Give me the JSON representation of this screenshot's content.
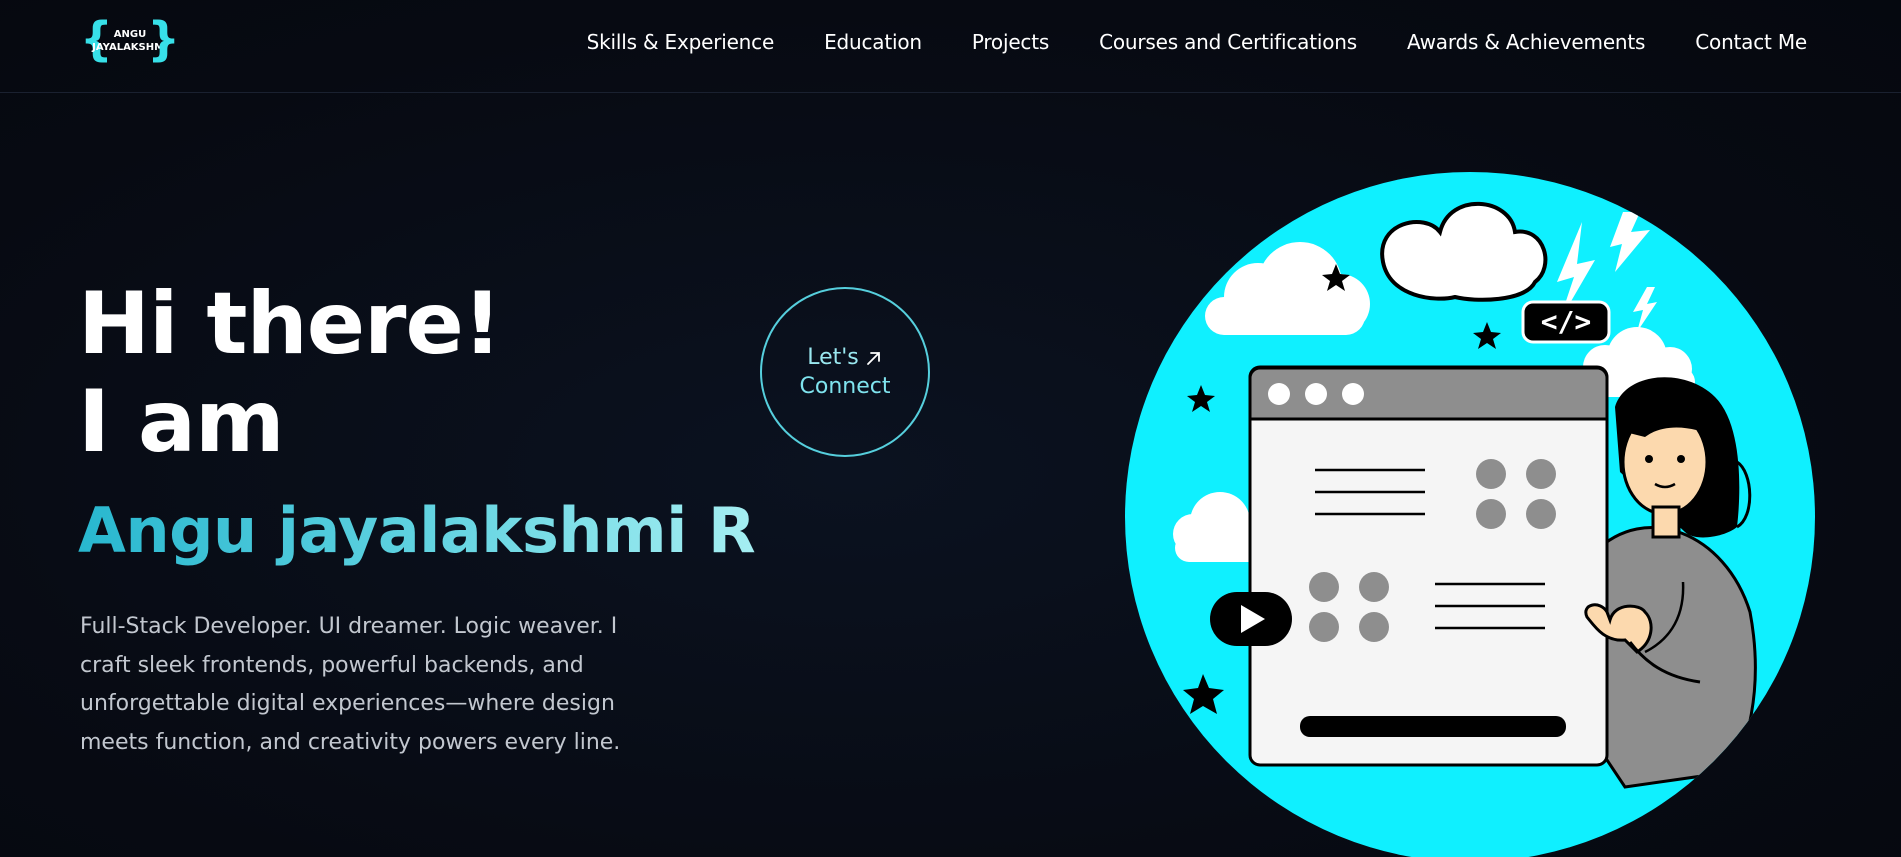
{
  "logo": {
    "line1": "ANGU",
    "line2": "JAYALAKSHMI"
  },
  "nav": {
    "items": [
      {
        "label": "Skills & Experience"
      },
      {
        "label": "Education"
      },
      {
        "label": "Projects"
      },
      {
        "label": "Courses and Certifications"
      },
      {
        "label": "Awards & Achievements"
      },
      {
        "label": "Contact Me"
      }
    ]
  },
  "hero": {
    "greeting": "Hi there!",
    "intro": "I am",
    "name": "Angu jayalakshmi R",
    "description": "Full-Stack Developer. UI dreamer. Logic weaver. I craft sleek frontends, powerful backends, and unforgettable digital experiences—where design meets function, and creativity powers every line."
  },
  "connect": {
    "line1": "Let's",
    "line2": "Connect",
    "icon": "arrow-up-right-icon"
  },
  "illustration": {
    "code_tag": "</>"
  },
  "colors": {
    "accent": "#0ff0ff",
    "background": "#070b14",
    "name_gradient_start": "#28b7cf",
    "name_gradient_end": "#a5eef2"
  }
}
